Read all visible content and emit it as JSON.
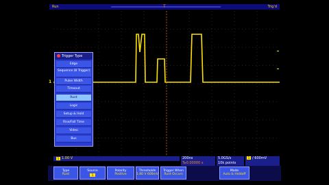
{
  "topbar": {
    "run_label": "Run",
    "trig_label": "Trig'd",
    "trigger_marker": "T"
  },
  "channel_marker": "1",
  "menu": {
    "title": "Trigger Type",
    "items": [
      {
        "label": "Edge"
      },
      {
        "label": "Sequence (B Trigger)"
      },
      {
        "label": "Pulse Width"
      },
      {
        "label": "Timeout"
      },
      {
        "label": "Runt",
        "selected": true
      },
      {
        "label": "Logic"
      },
      {
        "label": "Setup & Hold"
      },
      {
        "label": "Rise/Fall Time"
      },
      {
        "label": "Video"
      },
      {
        "label": "Bus"
      }
    ]
  },
  "status": {
    "ch_badge": "1",
    "ch_scale": "1.00 V",
    "timebase": "200ns",
    "timebase_sub": "T▸0.00000 s",
    "sample_rate": "5.0GS/s",
    "record_length": "10k points",
    "trig_badge": "1",
    "trig_level": "/ 600mV"
  },
  "bottom_buttons": [
    {
      "label": "Type",
      "sub": "Runt"
    },
    {
      "label": "Source",
      "chip": "1"
    },
    {
      "label": "Polarity",
      "sub": "Positive"
    },
    {
      "label": "Thresholds",
      "sub": "1.80 V 600mV"
    },
    {
      "label": "Trigger When",
      "sub": "Runt Occurs"
    },
    {
      "label": "Mode",
      "sub": "Auto & Holdoff"
    }
  ],
  "colors": {
    "trace": "#ffe400",
    "accent": "#3b55e6",
    "selected": "#8ec4ff"
  }
}
